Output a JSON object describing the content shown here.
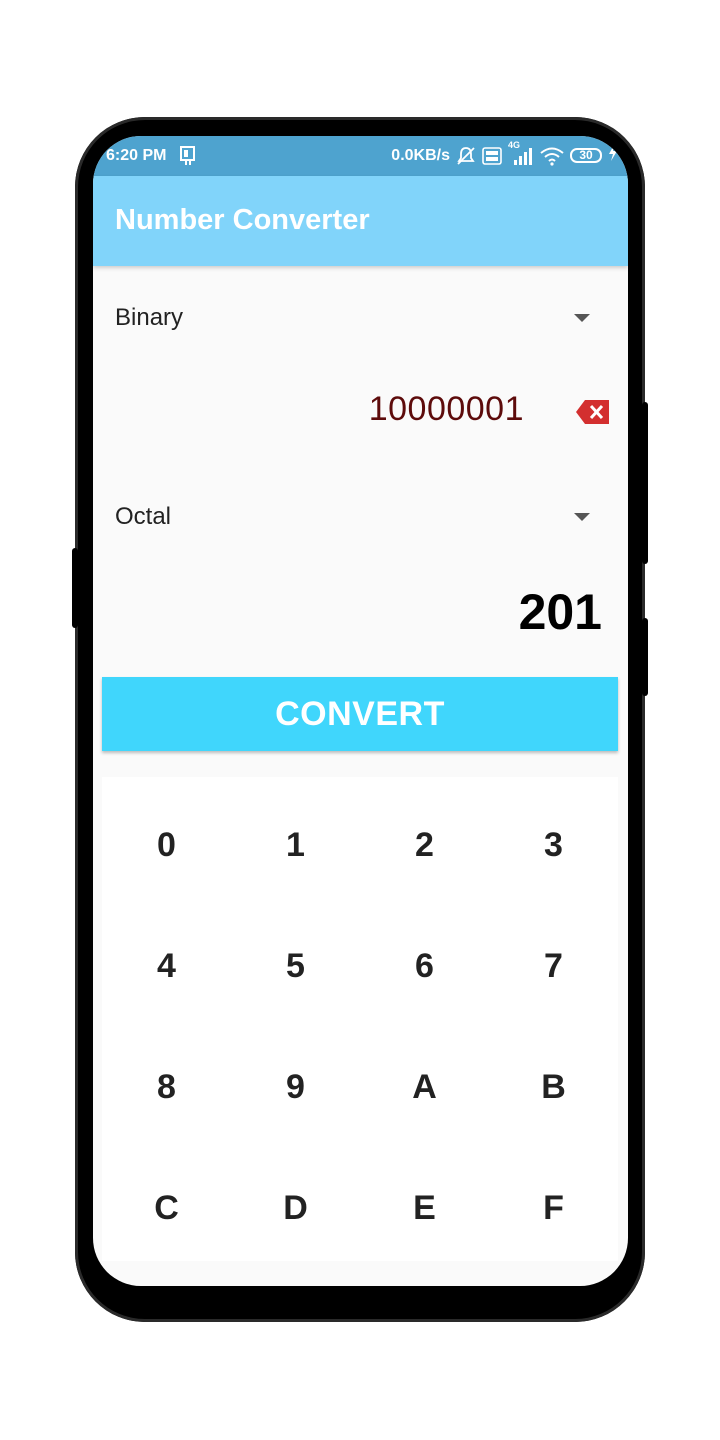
{
  "status_bar": {
    "time": "6:20 PM",
    "network_speed": "0.0KB/s",
    "signal_type": "4G",
    "battery_level": "30",
    "icons": [
      "sim-notification-icon",
      "mute-icon",
      "volte-icon",
      "signal-icon",
      "wifi-icon",
      "battery-icon",
      "charging-icon"
    ]
  },
  "app_bar": {
    "title": "Number Converter"
  },
  "from_spinner": {
    "selected": "Binary"
  },
  "input": {
    "value": "10000001"
  },
  "to_spinner": {
    "selected": "Octal"
  },
  "output": {
    "value": "201"
  },
  "convert_button": {
    "label": "CONVERT"
  },
  "keypad": {
    "keys": [
      "0",
      "1",
      "2",
      "3",
      "4",
      "5",
      "6",
      "7",
      "8",
      "9",
      "A",
      "B",
      "C",
      "D",
      "E",
      "F"
    ]
  },
  "colors": {
    "status_bar": "#4ea3cf",
    "app_bar": "#81d4fa",
    "convert_button": "#40d6fc",
    "input_text": "#5d0b0b",
    "clear_icon": "#d32f2f"
  }
}
